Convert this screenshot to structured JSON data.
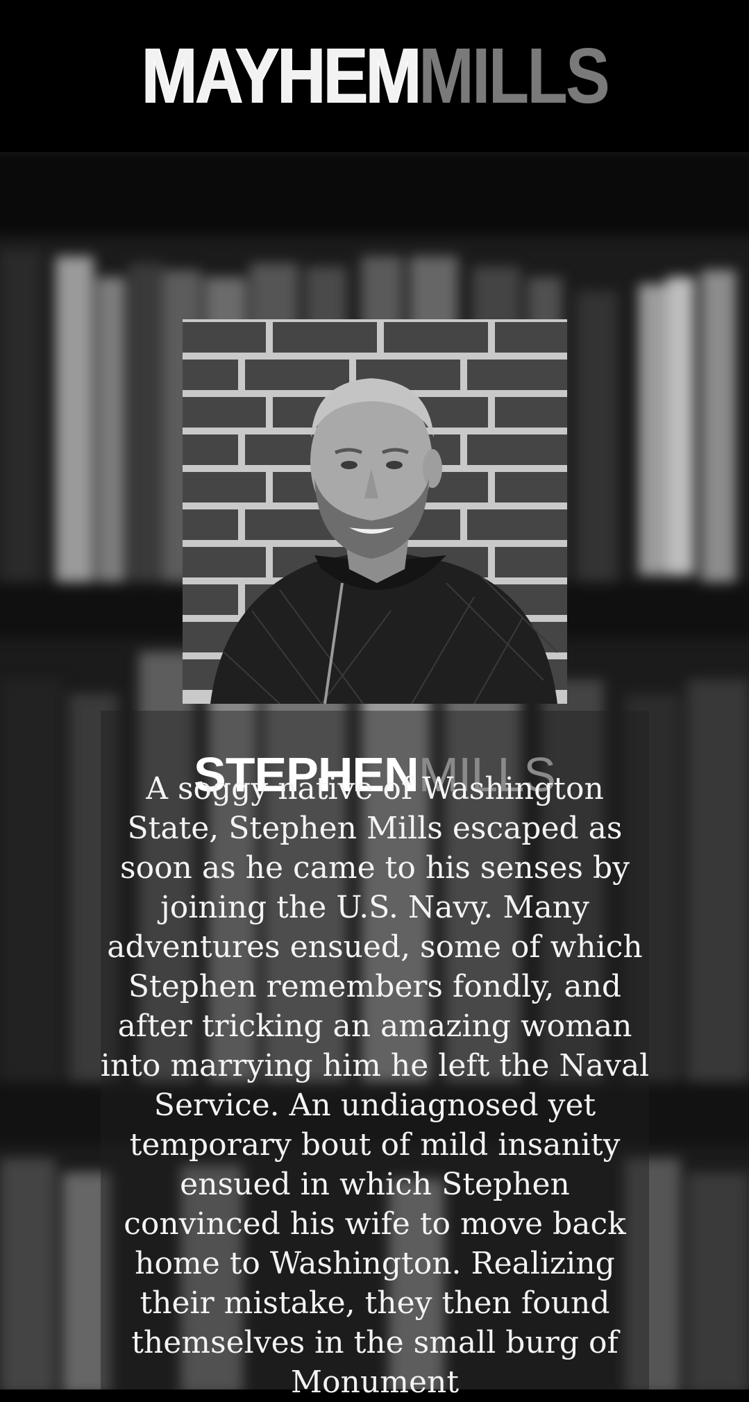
{
  "header": {
    "logo_part1": "MAYHEM",
    "logo_part2": "MILLS"
  },
  "author": {
    "first_name": "STEPHEN",
    "last_name": "MILLS",
    "bio": "A soggy native of Washington State, Stephen Mills escaped as soon as he came to his senses by joining the U.S. Navy. Many adventures ensued, some of which Stephen remembers fondly, and after tricking an amazing woman into marrying him he left the Naval Service. An undiagnosed yet temporary bout of mild insanity ensued in which Stephen convinced his wife to move back home to Washington. Realizing their mistake, they then found themselves in the small burg of Monument"
  },
  "colors": {
    "header_bg": "#000000",
    "logo_primary": "#f2f2f2",
    "logo_accent": "#7a7a7a",
    "name_primary": "#ffffff",
    "name_accent": "#8a8a8a",
    "bio_text": "#f4f4f4"
  }
}
